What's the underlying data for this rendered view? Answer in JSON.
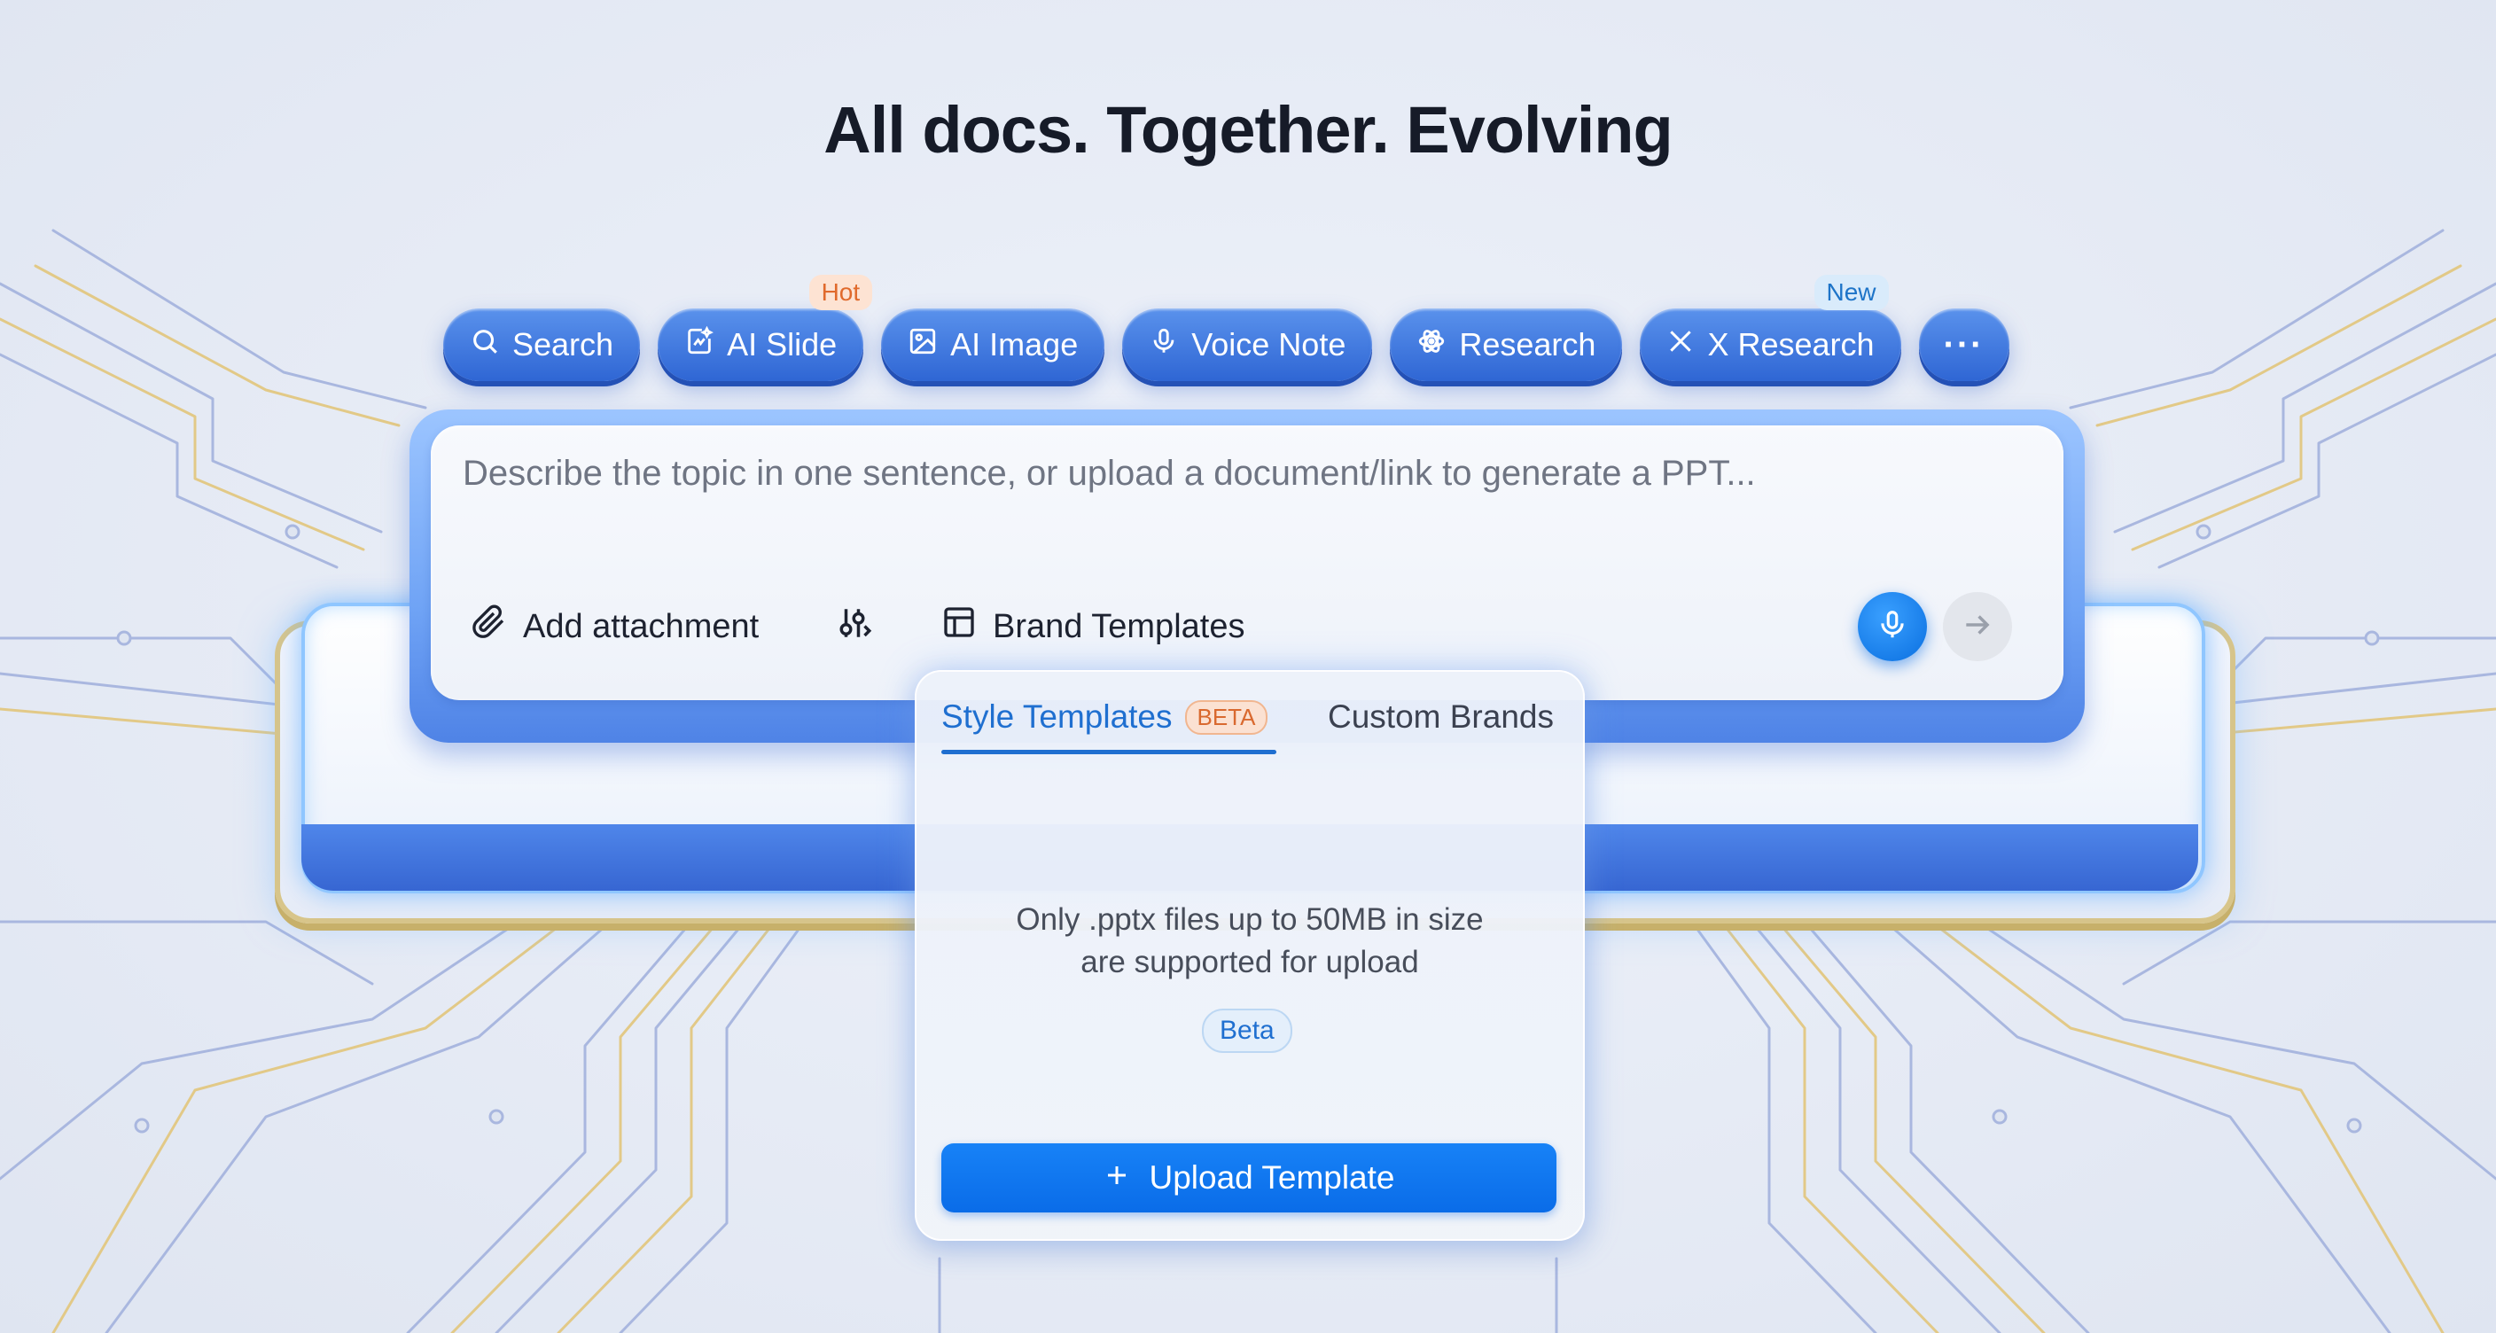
{
  "heading": "All docs. Together. Evolving",
  "chips": [
    {
      "label": "Search",
      "icon": "search-icon"
    },
    {
      "label": "AI Slide",
      "icon": "ai-slide-icon",
      "badge": "Hot"
    },
    {
      "label": "AI Image",
      "icon": "image-icon"
    },
    {
      "label": "Voice Note",
      "icon": "microphone-icon"
    },
    {
      "label": "Research",
      "icon": "research-icon"
    },
    {
      "label": "X Research",
      "icon": "x-logo-icon",
      "badge": "New"
    },
    {
      "label": "···",
      "icon": "more-icon"
    }
  ],
  "input": {
    "placeholder": "Describe the topic in one sentence, or upload a document/link to generate a PPT..."
  },
  "toolbar": {
    "attachment_label": "Add attachment",
    "brand_templates_label": "Brand Templates"
  },
  "popup": {
    "tab_style": "Style Templates",
    "tab_style_badge": "BETA",
    "tab_custom": "Custom Brands",
    "message_line1": "Only .pptx files up to 50MB in size",
    "message_line2": "are supported for upload",
    "beta_tag": "Beta",
    "upload_label": "Upload Template"
  },
  "colors": {
    "chip_blue": "#3b73db",
    "accent_blue": "#0a6ce8",
    "hot_badge": "#e06a2c",
    "new_badge": "#1e74c8"
  }
}
